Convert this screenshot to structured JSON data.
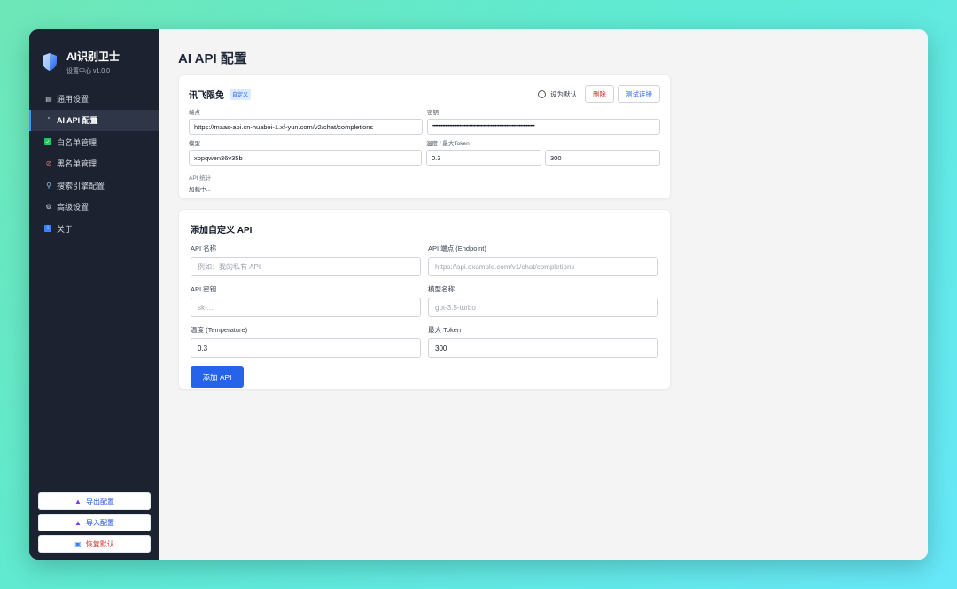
{
  "brand": {
    "title": "AI识别卫士",
    "subtitle": "设置中心 v1.0.0"
  },
  "nav": [
    {
      "icon": "▤",
      "label": "通用设置"
    },
    {
      "icon": "'",
      "label": "AI API 配置",
      "active": true
    },
    {
      "icon": "✓",
      "label": "白名单管理"
    },
    {
      "icon": "⊘",
      "label": "黑名单管理"
    },
    {
      "icon": "⚲",
      "label": "搜索引擎配置"
    },
    {
      "icon": "⚙",
      "label": "高级设置"
    },
    {
      "icon": "i",
      "label": "关于"
    }
  ],
  "side_buttons": {
    "export": "导出配置",
    "import": "导入配置",
    "reset": "恢复默认"
  },
  "page_title": "AI API 配置",
  "api_card": {
    "name": "讯飞限免",
    "badge": "自定义",
    "set_default": "设为默认",
    "delete": "删除",
    "test": "测试连接",
    "endpoint_label": "端点",
    "endpoint": "https://maas-api.cn-huabei-1.xf-yun.com/v2/chat/completions",
    "key_label": "密钥",
    "key": "••••••••••••••••••••••••••••••••••••••••••••••••••••••••••••••••••••••••",
    "model_label": "模型",
    "model": "xopqwen36v35b",
    "temp_label": "温度 / 最大Token",
    "temp": "0.3",
    "max_token": "300",
    "stats_label": "API 统计",
    "stats_value": "加载中..."
  },
  "add_card": {
    "title": "添加自定义 API",
    "name_label": "API 名称",
    "name_placeholder": "例如：我的私有 API",
    "endpoint_label": "API 端点 (Endpoint)",
    "endpoint_placeholder": "https://api.example.com/v1/chat/completions",
    "key_label": "API 密钥",
    "key_placeholder": "sk-...",
    "model_label": "模型名称",
    "model_placeholder": "gpt-3.5-turbo",
    "temp_label": "温度 (Temperature)",
    "temp_value": "0.3",
    "max_label": "最大 Token",
    "max_value": "300",
    "submit": "添加 API"
  },
  "colors": {
    "sidebar": "#1d2230",
    "accent": "#2563eb",
    "danger": "#dc2626"
  }
}
